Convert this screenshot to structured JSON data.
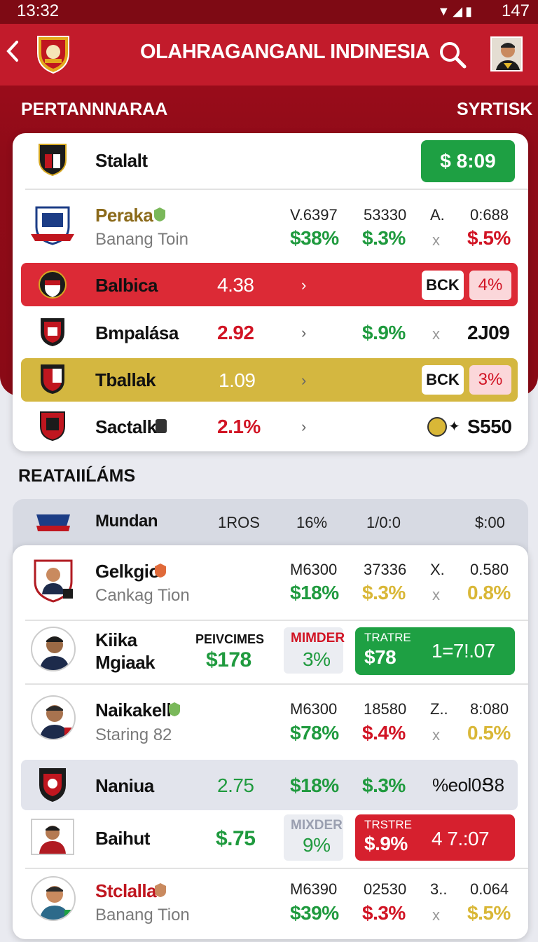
{
  "status": {
    "time": "13:32",
    "battery": "147"
  },
  "appbar": {
    "title": "OLAHRAGANGANL INDINESIA",
    "back_icon": "chevron-left-icon",
    "search_icon": "search-icon"
  },
  "section1": {
    "title": "PERTANNNARAA",
    "right": "SYRTISK"
  },
  "top_card": {
    "header": {
      "name": "Stalalt",
      "button": "$ 8:09"
    },
    "rows": [
      {
        "name": "Peraka",
        "sub": "Banang Toin",
        "c1_top": "V.6397",
        "c1_val": "$38%",
        "c2_top": "53330",
        "c2_val": "$.3%",
        "c3_top": "A.",
        "c3_val": "x",
        "c4_top": "0:688",
        "c4_val": "$.5%"
      },
      {
        "name": "Balbica",
        "odds": "4.38",
        "pill": "BCK",
        "pill2": "4%"
      },
      {
        "name": "Bmpalása",
        "odds": "2.92",
        "val": "$.9%",
        "x": "x",
        "right": "2J09"
      },
      {
        "name": "Tballak",
        "odds": "1.09",
        "pill": "BCK",
        "pill2": "3%"
      },
      {
        "name": "Sactalk",
        "odds": "2.1%",
        "right": "S550"
      }
    ]
  },
  "section2": {
    "title": "REATAIIĹÁMS"
  },
  "bottom_header": {
    "name": "Mundan",
    "c1": "1ROS",
    "c2": "16%",
    "c3": "1/0:0",
    "c4": "$:00"
  },
  "bottom_rows": [
    {
      "name": "Gelkgio",
      "sub": "Cankag Tion",
      "c1_top": "M6300",
      "c1_val": "$18%",
      "c2_top": "37336",
      "c2_val": "$.3%",
      "c3_top": "X.",
      "c3_val": "x",
      "c4_top": "0.580",
      "c4_val": "0.8%"
    },
    {
      "name": "Kiika",
      "name2": "Mgiaak",
      "label": "PEIVCIMES",
      "val": "$178",
      "chip_top": "MIMDER",
      "chip_val": "3%",
      "btn_top": "TRATRE",
      "btn_val": "$78",
      "btn_right": "1=7!.07"
    },
    {
      "name": "Naikakell",
      "sub": "Staring 82",
      "c1_top": "M6300",
      "c1_val": "$78%",
      "c2_top": "18580",
      "c2_val": "$.4%",
      "c3_top": "Z..",
      "c3_val": "x",
      "c4_top": "8:080",
      "c4_val": "0.5%"
    },
    {
      "name": "Naniua",
      "v1": "2.75",
      "v2": "$18%",
      "v3": "$.3%",
      "v4": "%eol0Ց8"
    },
    {
      "name": "Baihut",
      "val": "$.75",
      "chip_top": "MIXDER",
      "chip_val": "9%",
      "btn_top": "TRSTRE",
      "btn_val": "$.9%",
      "btn_right": "4  7.:07"
    },
    {
      "name": "Stclalla",
      "sub": "Banang Tion",
      "c1_top": "M6390",
      "c1_val": "$39%",
      "c2_top": "02530",
      "c2_val": "$.3%",
      "c3_top": "3..",
      "c3_val": "x",
      "c4_top": "0.064",
      "c4_val": "$.5%"
    }
  ]
}
